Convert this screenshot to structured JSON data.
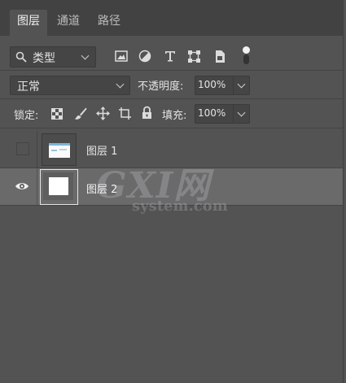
{
  "tabs": [
    {
      "label": "图层"
    },
    {
      "label": "通道"
    },
    {
      "label": "路径"
    }
  ],
  "filter": {
    "label": "类型"
  },
  "blend": {
    "mode": "正常",
    "opacity_label": "不透明度:",
    "opacity_value": "100%"
  },
  "lock": {
    "label": "锁定:",
    "fill_label": "填充:",
    "fill_value": "100%"
  },
  "layers": [
    {
      "name": "图层 1",
      "visible": false,
      "selected": false
    },
    {
      "name": "图层 2",
      "visible": true,
      "selected": true
    }
  ],
  "watermark": {
    "logo": "GXI网",
    "domain": "system.com"
  },
  "colors": {
    "panel": "#535353",
    "tabbar": "#424242",
    "selected_row": "#6a6a6a",
    "text": "#e4e4e4"
  }
}
